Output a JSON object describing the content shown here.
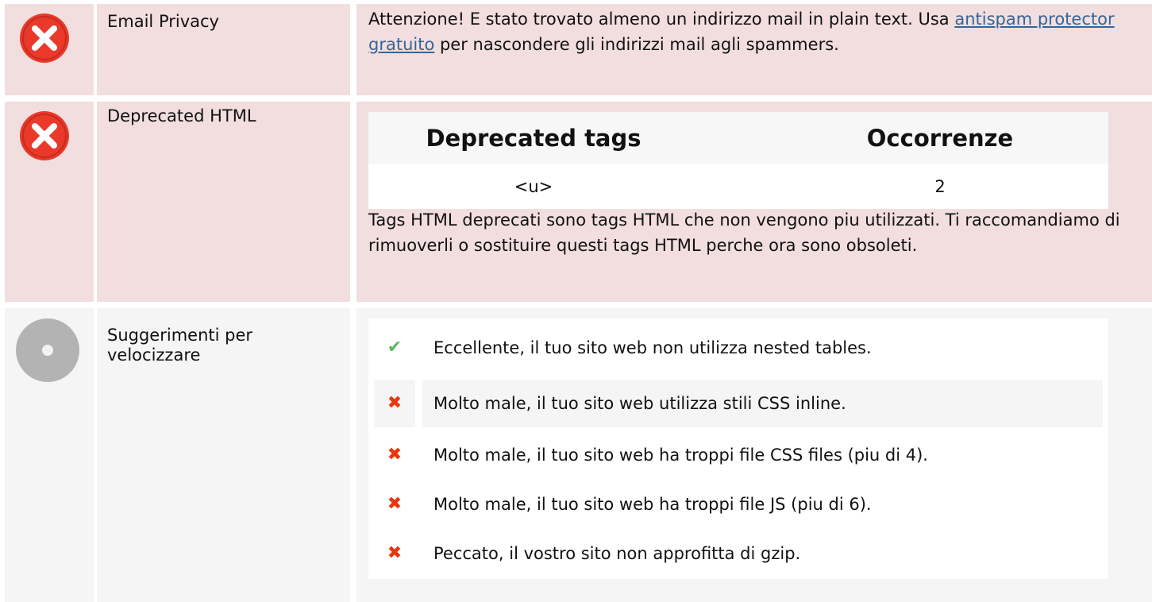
{
  "rows": [
    {
      "status": "error",
      "label": "Email Privacy",
      "text_before": "Attenzione! E stato trovato almeno un indirizzo mail in plain text. Usa ",
      "link_text": "antispam protector gratuito",
      "text_after": " per nascondere gli indirizzi mail agli spammers."
    },
    {
      "status": "error",
      "label": "Deprecated HTML",
      "table": {
        "headers": [
          "Deprecated tags",
          "Occorrenze"
        ],
        "rows": [
          [
            "<u>",
            "2"
          ]
        ]
      },
      "note": "Tags HTML deprecati sono tags HTML che non vengono piu utilizzati. Ti raccomandiamo di rimuoverli o sostituire questi tags HTML perche ora sono obsoleti."
    },
    {
      "status": "neutral",
      "label": "Suggerimenti per velocizzare",
      "tips": [
        {
          "state": "ok",
          "icon": "check-icon",
          "text": "Eccellente, il tuo sito web non utilizza nested tables."
        },
        {
          "state": "bad",
          "icon": "cross-icon",
          "text": "Molto male, il tuo sito web utilizza stili CSS inline."
        },
        {
          "state": "bad",
          "icon": "cross-icon",
          "text": "Molto male, il tuo sito web ha troppi file CSS files (piu di 4)."
        },
        {
          "state": "bad",
          "icon": "cross-icon",
          "text": "Molto male, il tuo sito web ha troppi file JS (piu di 6)."
        },
        {
          "state": "bad",
          "icon": "cross-icon",
          "text": "Peccato, il vostro sito non approfitta di gzip."
        }
      ]
    }
  ],
  "colors": {
    "error_bg": "#f2dede",
    "neutral_bg": "#f5f5f5",
    "error_icon": "#e8392b",
    "neutral_icon": "#b3b3b3",
    "link": "#336699",
    "ok": "#5cb85c",
    "bad": "#e8370c"
  }
}
